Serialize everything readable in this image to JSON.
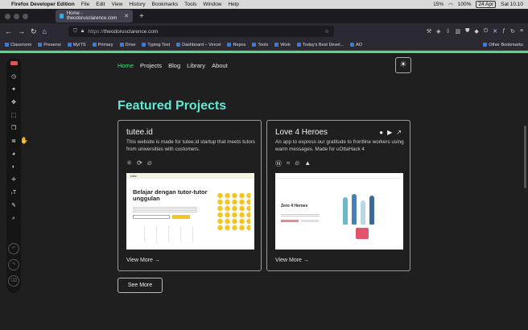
{
  "os_menubar": {
    "apple": "",
    "app": "Firefox Developer Edition",
    "menus": [
      "File",
      "Edit",
      "View",
      "History",
      "Bookmarks",
      "Tools",
      "Window",
      "Help"
    ],
    "battery_small": "15%",
    "battery": "100%",
    "date": "24 Apr",
    "time": "Sat 10.10"
  },
  "tab": {
    "title": "Home - theodorusclarence.com",
    "close": "✕",
    "new": "+"
  },
  "navbar": {
    "url_prefix": "https://",
    "url": "theodorusclarence.com"
  },
  "bookmarks": [
    "Classroom",
    "Presensi",
    "MyITS",
    "Primary",
    "Drive",
    "Typing Test",
    "Dashboard – Vercel",
    "Repos",
    "Tools",
    "Work",
    "Today's Best Devel...",
    "AO"
  ],
  "bookmarks_other": "Other Bookmarks",
  "site": {
    "nav": [
      "Home",
      "Projects",
      "Blog",
      "Library",
      "About"
    ],
    "theme_icon": "☀",
    "heading": "Featured Projects",
    "see_more": "See More",
    "cards": [
      {
        "title": "tutee.id",
        "desc": "This website is made for tutee.id startup that meets tutors from universities with customers.",
        "view_more": "View More →",
        "shot_brand": "tutee",
        "shot_title": "Belajar dengan tutor-tutor unggulan"
      },
      {
        "title": "Love 4 Heroes",
        "desc": "An app to express our gratitude to frontline workers using warm messages. Made for uOttaHack 4",
        "view_more": "View More →",
        "shot_title": "Zero 4 Heroes"
      }
    ]
  },
  "colors": {
    "accent": "#4ade80",
    "heading": "#5eead4",
    "background": "#1f1f1f"
  }
}
